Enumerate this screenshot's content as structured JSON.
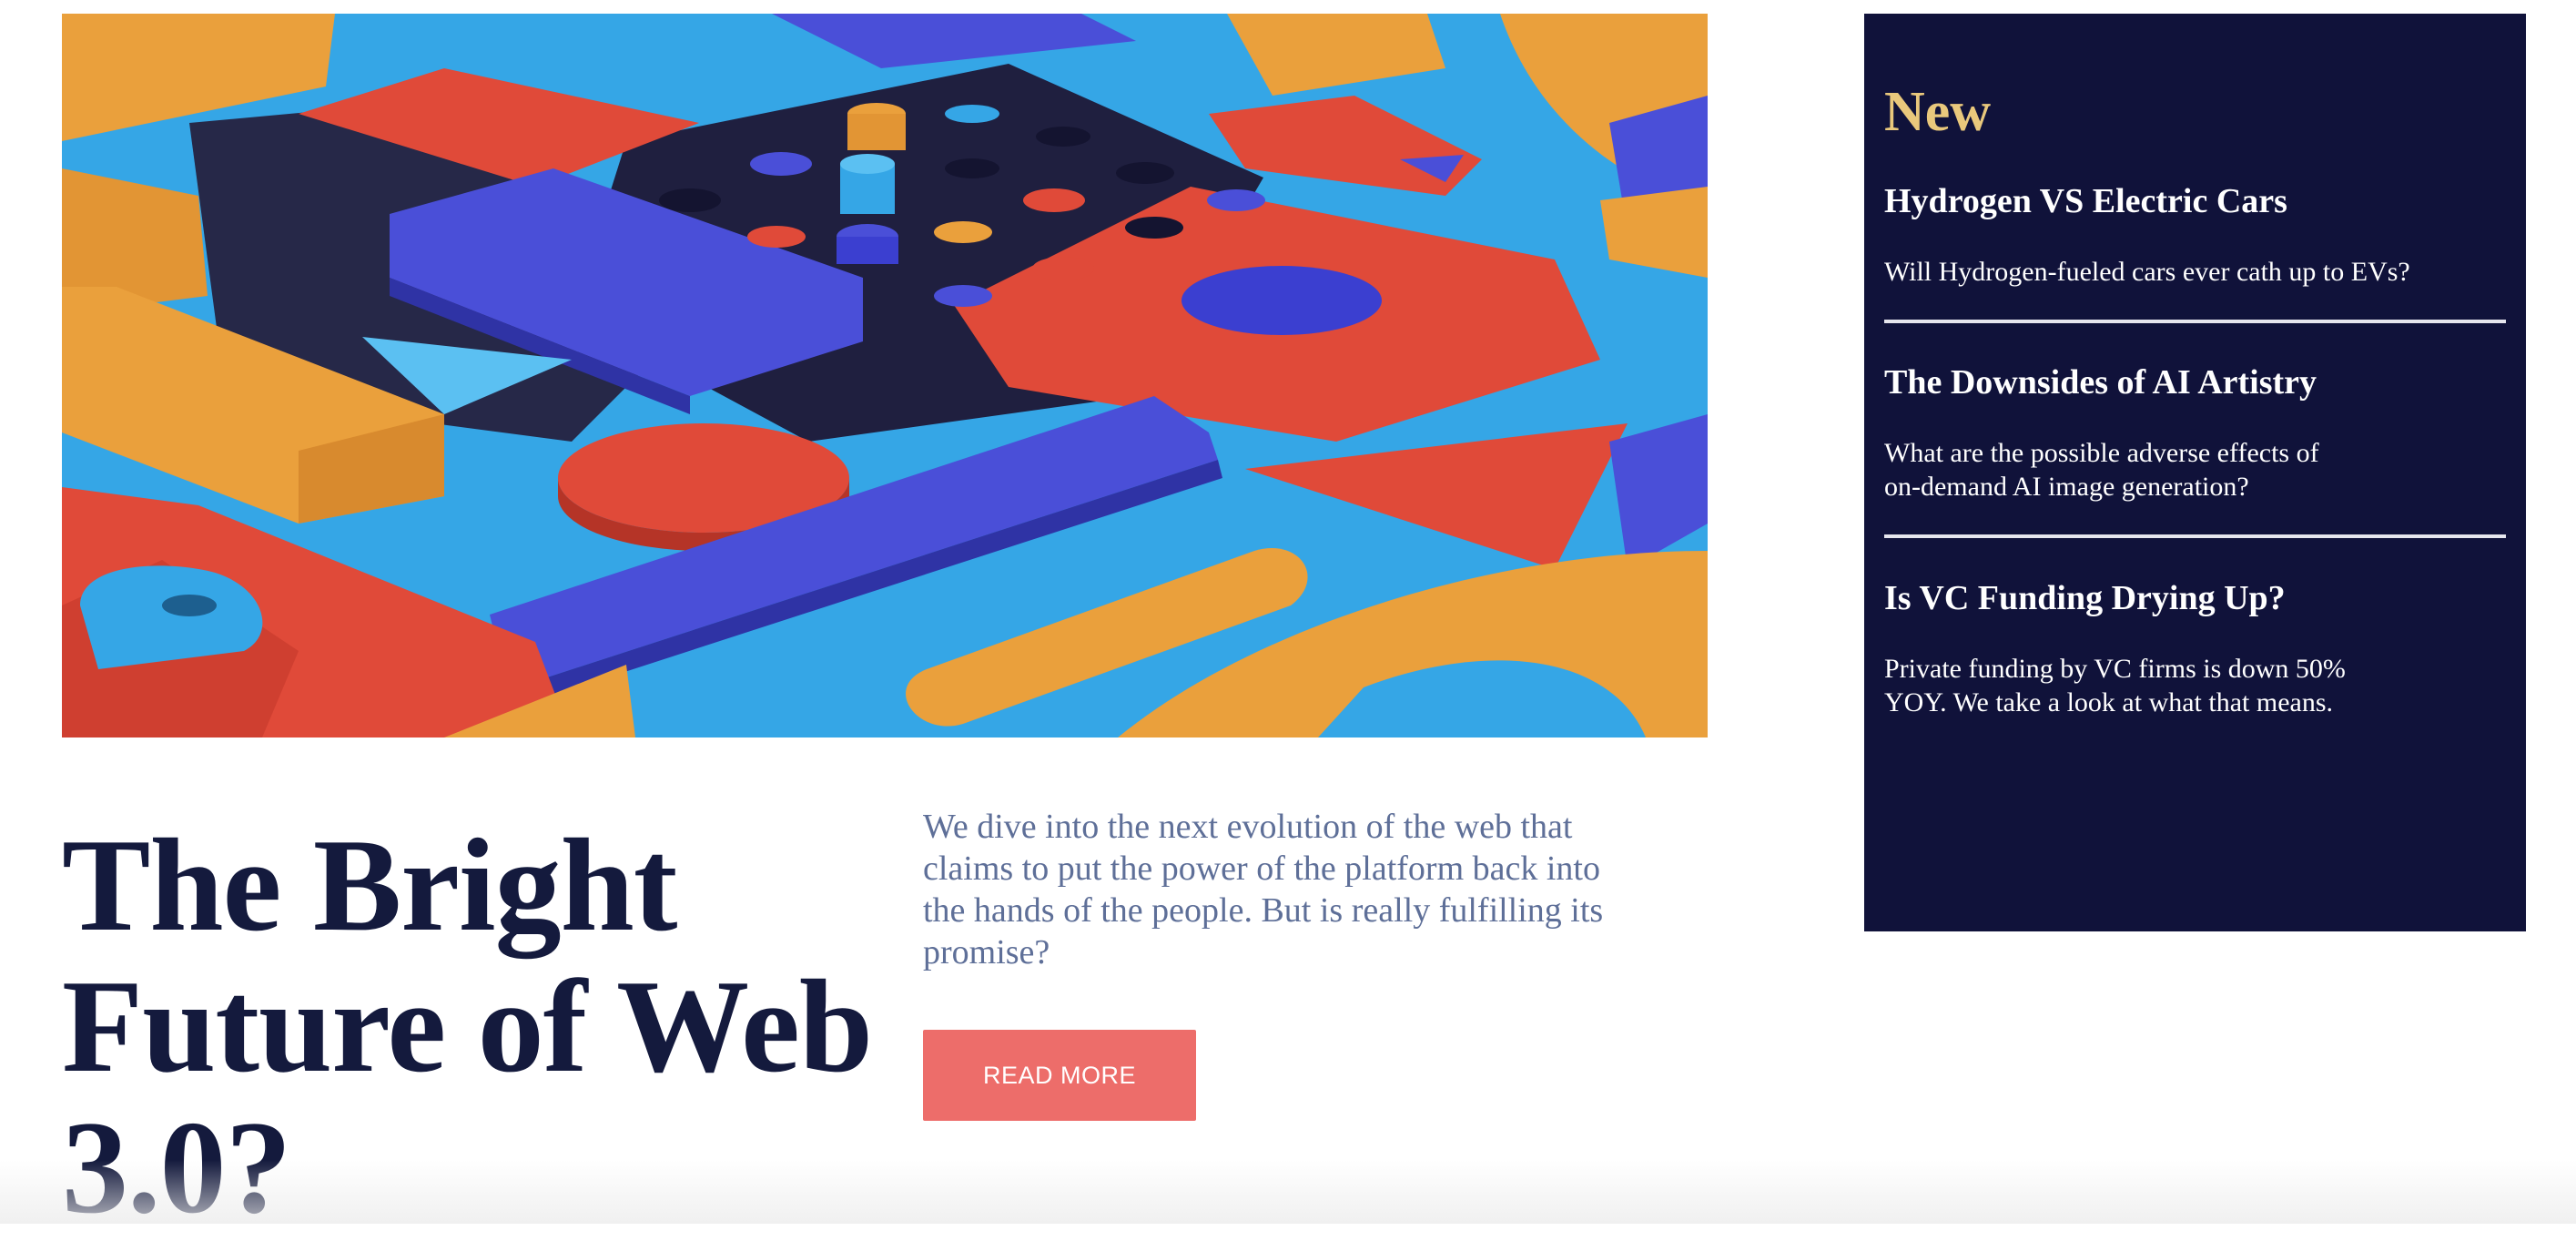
{
  "hero": {
    "image_alt": "Colorful 3D geometric blocks in blue, red and orange",
    "colors": {
      "sky_blue": "#35a6e6",
      "navy": "#1f1f3f",
      "indigo": "#4a4fd8",
      "red": "#e04a39",
      "orange": "#eaa03c"
    }
  },
  "main": {
    "headline": "The Bright Future of Web 3.0?",
    "summary": "We dive into the next evolution of the web that claims to put the power of the platform back into the hands of the people. But is really fulfilling its promise?",
    "read_more_label": "READ MORE"
  },
  "sidebar": {
    "title": "New",
    "articles": [
      {
        "title": "Hydrogen VS Electric Cars",
        "description": "Will Hydrogen-fueled cars ever cath up to EVs?"
      },
      {
        "title": "The Downsides of AI Artistry",
        "description": "What are the possible adverse effects of\non-demand AI image generation?"
      },
      {
        "title": "Is VC Funding Drying Up?",
        "description": "Private funding by VC firms is down 50%\nYOY. We take a look at what that means."
      }
    ]
  },
  "theme": {
    "accent": "#ed6d6a",
    "dark_navy": "#10123a",
    "gold": "#e9c87c",
    "heading_text": "#141a3d",
    "muted_text": "#5e6f98"
  }
}
